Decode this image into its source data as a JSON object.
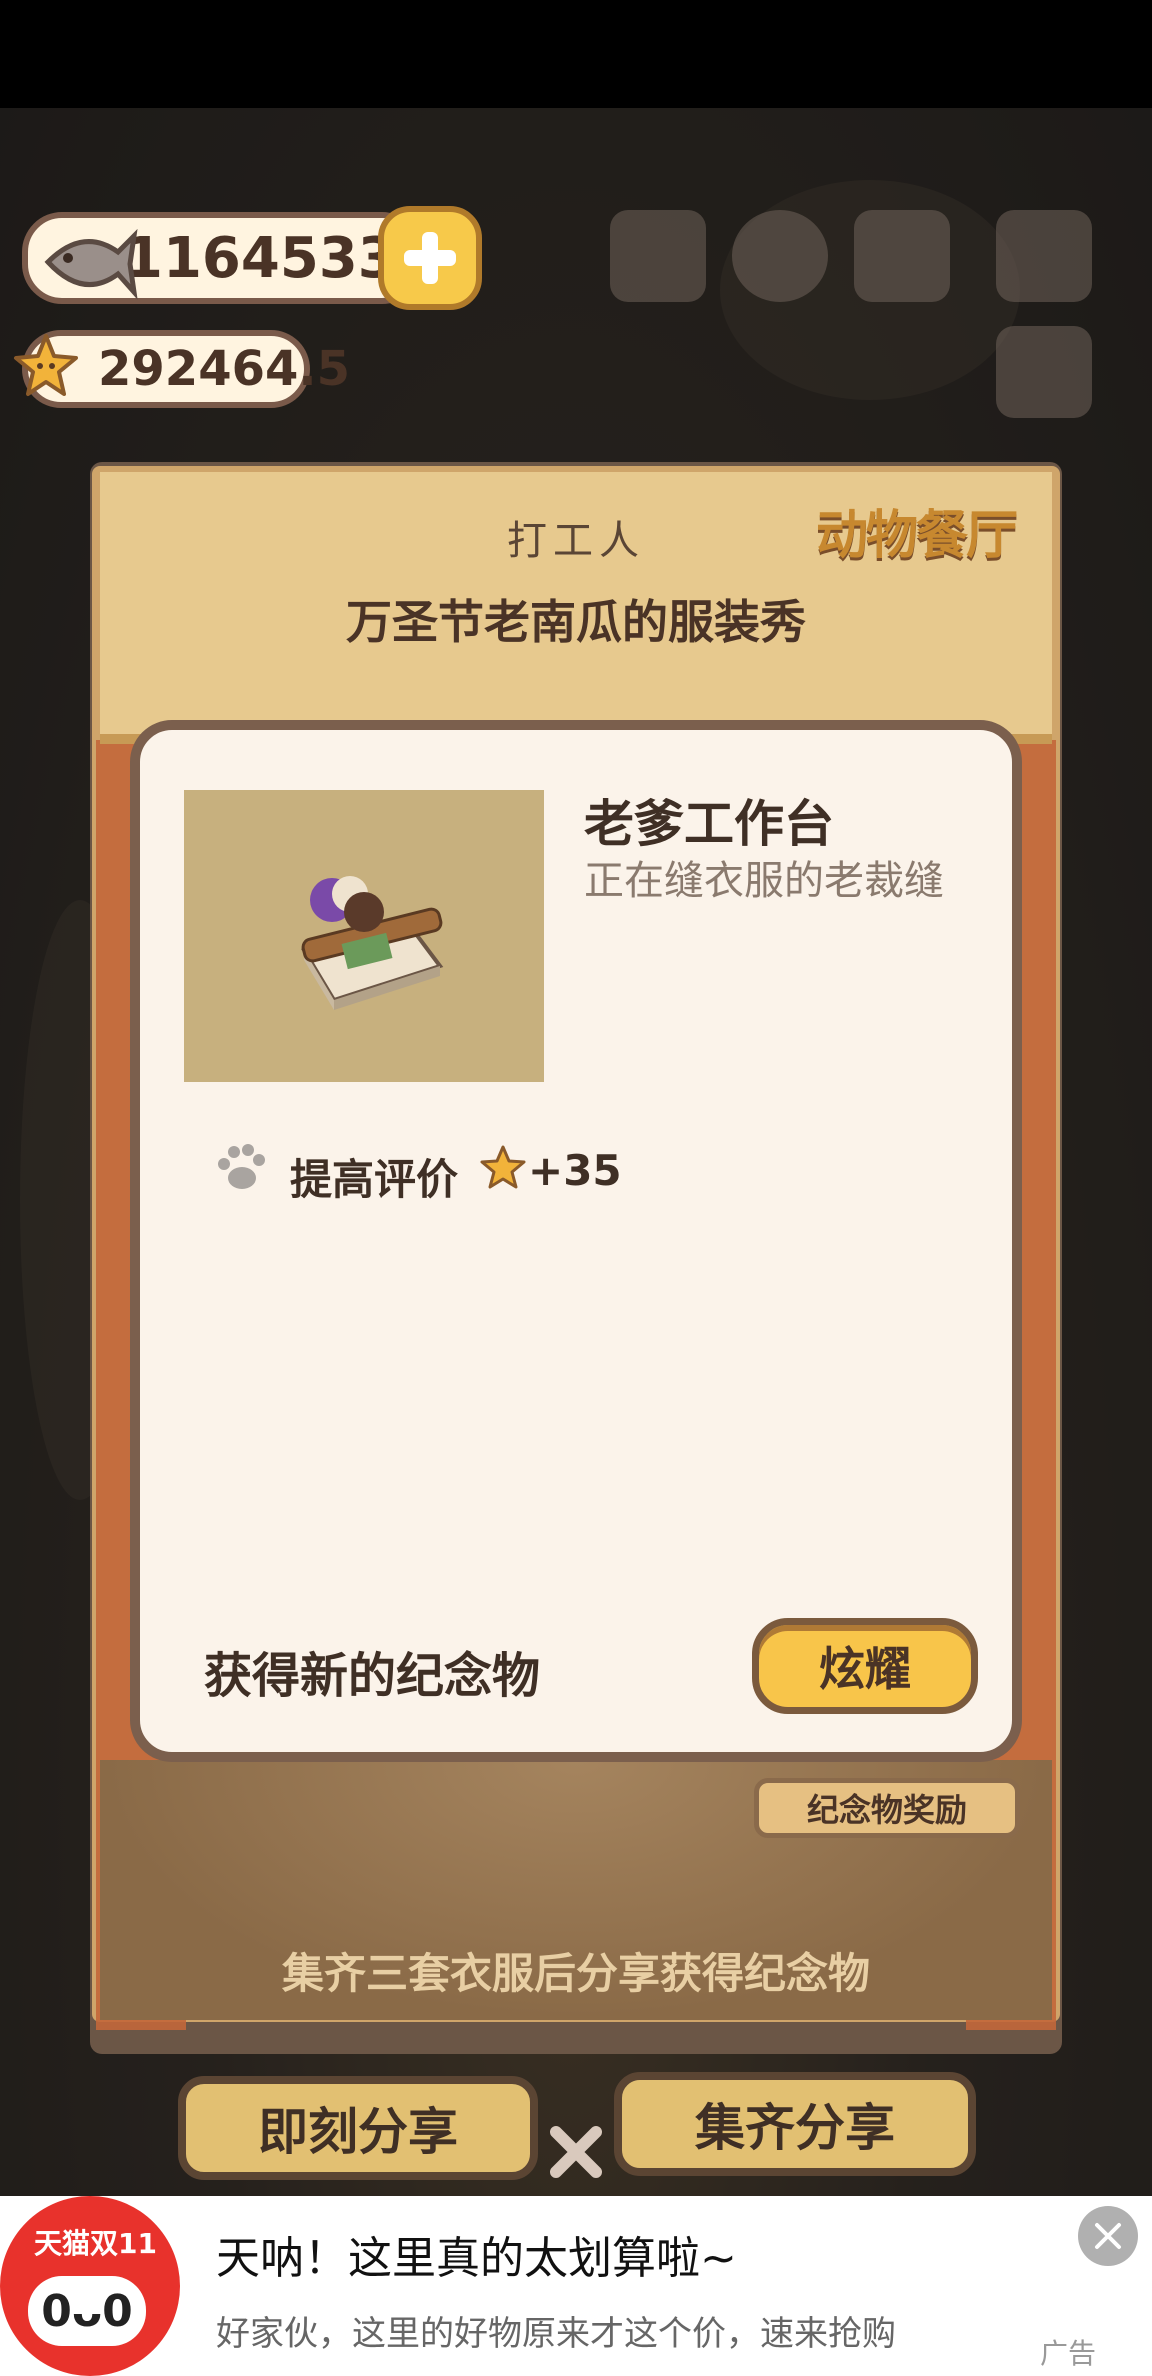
{
  "hud": {
    "fish_count": "11645331",
    "star_count": "292464.5"
  },
  "popup": {
    "worker_label": "打工人",
    "show_title": "万圣节老南瓜的服装秀",
    "logo_text": "动物餐厅",
    "item": {
      "name": "老爹工作台",
      "description": "正在缝衣服的老裁缝"
    },
    "bonus": {
      "label": "提高评价",
      "value": "+35"
    },
    "new_souvenir_label": "获得新的纪念物",
    "show_off_button": "炫耀",
    "souvenir_reward_tag": "纪念物奖励",
    "collect_hint": "集齐三套衣服后分享获得纪念物"
  },
  "buttons": {
    "share_now": "即刻分享",
    "share_all": "集齐分享"
  },
  "ad": {
    "logo_text": "天猫双11",
    "title": "天呐！这里真的太划算啦~",
    "subtitle": "好家伙，这里的好物原来才这个价，速来抢购",
    "tag": "广告"
  },
  "colors": {
    "accent_yellow": "#f8c54a",
    "card_bg": "#fbf3ea",
    "panel_brown": "#7b5f4d",
    "ad_red": "#e8322c"
  }
}
